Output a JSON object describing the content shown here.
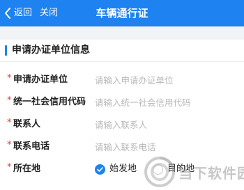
{
  "nav": {
    "back_label": "返回",
    "close_label": "关闭",
    "title": "车辆通行证"
  },
  "section": {
    "title": "申请办证单位信息"
  },
  "form": {
    "required_mark": "*",
    "fields": [
      {
        "label": "申请办证单位",
        "value": "",
        "placeholder": "请输入申请办证单位"
      },
      {
        "label": "统一社会信用代码",
        "value": "",
        "placeholder": "请输入统一社会信用代码"
      },
      {
        "label": "联系人",
        "value": "",
        "placeholder": "请输入联系人"
      },
      {
        "label": "联系电话",
        "value": "",
        "placeholder": "请输入联系电话"
      }
    ],
    "location": {
      "label": "所在地",
      "options": [
        {
          "label": "始发地",
          "checked": true
        },
        {
          "label": "目的地",
          "checked": false
        }
      ]
    }
  },
  "watermark": {
    "text": "当下软件园"
  },
  "colors": {
    "accent": "#1e82f0",
    "required": "#e53935",
    "placeholder": "#b7b7b7",
    "background": "#f2f3f5"
  }
}
